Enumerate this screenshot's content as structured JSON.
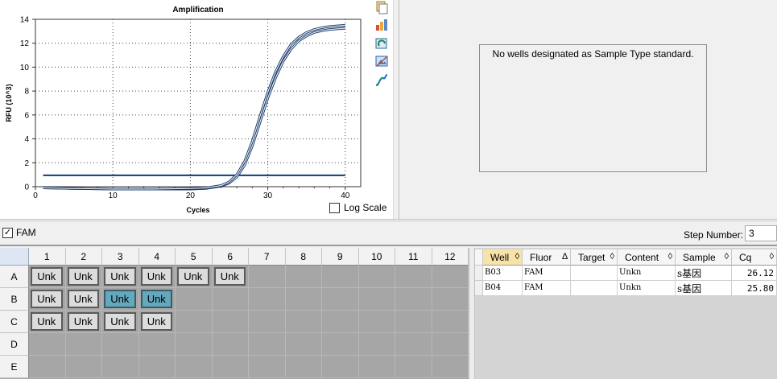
{
  "chart": {
    "title": "Amplification",
    "xlabel": "Cycles",
    "ylabel": "RFU (10^3)",
    "log_scale_label": "Log Scale",
    "log_scale_checked": false
  },
  "chart_data": {
    "type": "line",
    "title": "Amplification",
    "xlabel": "Cycles",
    "ylabel": "RFU (10^3)",
    "xlim": [
      0,
      42
    ],
    "ylim": [
      0,
      14
    ],
    "x_ticks": [
      0,
      10,
      20,
      30,
      40
    ],
    "y_ticks": [
      0,
      2,
      4,
      6,
      8,
      10,
      12,
      14
    ],
    "grid": true,
    "threshold": {
      "y": 0.95,
      "x_range": [
        1,
        40
      ]
    },
    "series": [
      {
        "well": "B03",
        "cq": 26.12,
        "x": [
          1,
          5,
          10,
          15,
          20,
          22,
          24,
          25,
          26,
          27,
          28,
          29,
          30,
          31,
          32,
          33,
          34,
          35,
          36,
          37,
          38,
          39,
          40
        ],
        "y": [
          -0.1,
          -0.15,
          -0.2,
          -0.2,
          -0.2,
          -0.15,
          0.05,
          0.3,
          0.8,
          1.8,
          3.4,
          5.4,
          7.4,
          9.1,
          10.5,
          11.5,
          12.2,
          12.6,
          12.9,
          13.05,
          13.15,
          13.2,
          13.25
        ]
      },
      {
        "well": "B04",
        "cq": 25.8,
        "x": [
          1,
          5,
          10,
          15,
          20,
          22,
          24,
          25,
          26,
          27,
          28,
          29,
          30,
          31,
          32,
          33,
          34,
          35,
          36,
          37,
          38,
          39,
          40
        ],
        "y": [
          -0.1,
          -0.15,
          -0.2,
          -0.2,
          -0.15,
          -0.1,
          0.1,
          0.4,
          1.0,
          2.1,
          3.8,
          5.9,
          7.9,
          9.6,
          10.9,
          11.9,
          12.5,
          12.9,
          13.15,
          13.3,
          13.4,
          13.45,
          13.5
        ]
      }
    ]
  },
  "toolbar": {
    "icons": [
      "copy-icon",
      "chart-export-icon",
      "refresh-chart-icon",
      "image-export-icon",
      "curve-fit-icon"
    ]
  },
  "standard_panel": {
    "message": "No wells designated as Sample Type standard."
  },
  "controls": {
    "fluor_label": "FAM",
    "fluor_checked": true,
    "step_label": "Step Number:",
    "step_value": "3"
  },
  "plate": {
    "columns": [
      "1",
      "2",
      "3",
      "4",
      "5",
      "6",
      "7",
      "8",
      "9",
      "10",
      "11",
      "12"
    ],
    "rows": [
      "A",
      "B",
      "C",
      "D",
      "E"
    ],
    "wells": [
      [
        "Unk",
        "Unk",
        "Unk",
        "Unk",
        "Unk",
        "Unk",
        "",
        "",
        "",
        "",
        "",
        ""
      ],
      [
        "Unk",
        "Unk",
        "Unk",
        "Unk",
        "",
        "",
        "",
        "",
        "",
        "",
        "",
        ""
      ],
      [
        "Unk",
        "Unk",
        "Unk",
        "Unk",
        "",
        "",
        "",
        "",
        "",
        "",
        "",
        ""
      ],
      [
        "",
        "",
        "",
        "",
        "",
        "",
        "",
        "",
        "",
        "",
        "",
        ""
      ],
      [
        "",
        "",
        "",
        "",
        "",
        "",
        "",
        "",
        "",
        "",
        "",
        ""
      ]
    ],
    "selected": [
      [
        1,
        2
      ],
      [
        1,
        3
      ]
    ]
  },
  "table": {
    "headers": [
      "Well",
      "Fluor",
      "Target",
      "Content",
      "Sample",
      "Cq"
    ],
    "sort_icons": [
      "◊",
      "∆",
      "◊",
      "◊",
      "◊",
      "◊"
    ],
    "rows": [
      [
        "B03",
        "FAM",
        "",
        "Unkn",
        "s基因",
        "26.12"
      ],
      [
        "B04",
        "FAM",
        "",
        "Unkn",
        "s基因",
        "25.80"
      ]
    ]
  },
  "colors": {
    "curve": "#1d3e6e",
    "threshold": "#103c74",
    "selected_well": "#63a8bc",
    "well": "#dcdcdc"
  }
}
